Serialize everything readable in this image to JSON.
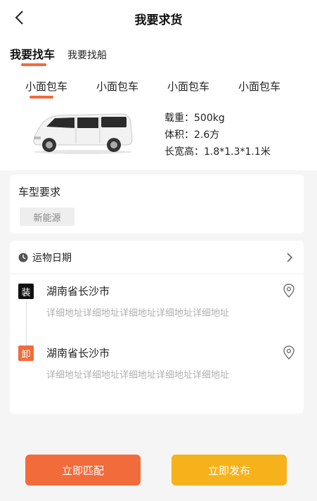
{
  "header": {
    "title": "我要求货"
  },
  "tabs": {
    "active": "我要找车",
    "other": "我要找船"
  },
  "vehicle_types": [
    "小面包车",
    "小面包车",
    "小面包车",
    "小面包车"
  ],
  "specs": {
    "load": "载重：500kg",
    "volume": "体积：2.6方",
    "dimensions": "长宽高：1.8*1.3*1.1米"
  },
  "requirement": {
    "title": "车型要求",
    "tag": "新能源"
  },
  "route": {
    "date_label": "运物日期",
    "load": {
      "badge": "装",
      "city": "湖南省长沙市",
      "detail": "详细地址详细地址详细地址详细地址详细地址"
    },
    "unload": {
      "badge": "卸",
      "city": "湖南省长沙市",
      "detail": "详细地址详细地址详细地址详细地址详细地址"
    }
  },
  "buttons": {
    "match": "立即匹配",
    "publish": "立即发布"
  },
  "colors": {
    "accent": "#f26b3a",
    "publish": "#f5b21b",
    "load_badge": "#111111"
  },
  "icons": [
    "back-arrow-icon",
    "clock-icon",
    "chevron-right-icon",
    "location-pin-icon",
    "van-image"
  ]
}
